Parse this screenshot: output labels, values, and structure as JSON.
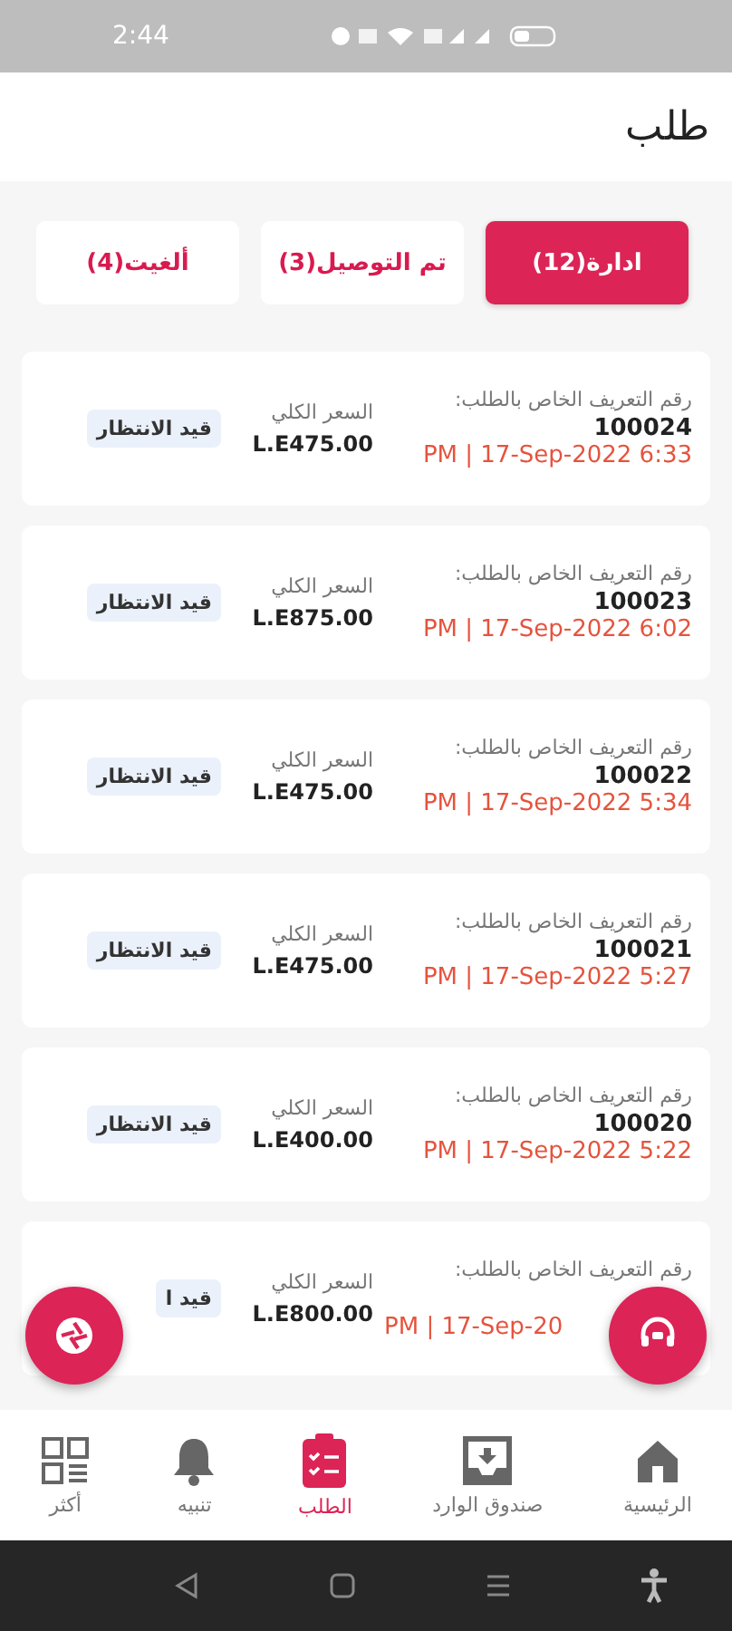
{
  "status_bar": {
    "time": "2:44"
  },
  "header": {
    "title": "طلب"
  },
  "tabs": [
    {
      "label": "ادارة(12)",
      "selected": true
    },
    {
      "label": "تم التوصيل(3)",
      "selected": false
    },
    {
      "label": "ألغيت(4)",
      "selected": false
    }
  ],
  "orders": [
    {
      "id_label": "رقم التعريف الخاص بالطلب:",
      "id": "100024",
      "date": "PM | 17-Sep-2022 6:33",
      "price_label": "السعر الكلي",
      "price": "L.E475.00",
      "status": "قيد الانتظار"
    },
    {
      "id_label": "رقم التعريف الخاص بالطلب:",
      "id": "100023",
      "date": "PM | 17-Sep-2022 6:02",
      "price_label": "السعر الكلي",
      "price": "L.E875.00",
      "status": "قيد الانتظار"
    },
    {
      "id_label": "رقم التعريف الخاص بالطلب:",
      "id": "100022",
      "date": "PM | 17-Sep-2022 5:34",
      "price_label": "السعر الكلي",
      "price": "L.E475.00",
      "status": "قيد الانتظار"
    },
    {
      "id_label": "رقم التعريف الخاص بالطلب:",
      "id": "100021",
      "date": "PM | 17-Sep-2022 5:27",
      "price_label": "السعر الكلي",
      "price": "L.E475.00",
      "status": "قيد الانتظار"
    },
    {
      "id_label": "رقم التعريف الخاص بالطلب:",
      "id": "100020",
      "date": "PM | 17-Sep-2022 5:22",
      "price_label": "السعر الكلي",
      "price": "L.E400.00",
      "status": "قيد الانتظار"
    },
    {
      "id_label": "رقم التعريف الخاص بالطلب:",
      "date": "PM | 17-Sep-20",
      "price_label": "السعر الكلي",
      "price": "L.E800.00",
      "status": "قيد ا"
    }
  ],
  "bottom_nav": [
    {
      "label": "الرئيسية",
      "kind": "home",
      "selected": false
    },
    {
      "label": "صندوق الوارد",
      "kind": "inbox",
      "selected": false
    },
    {
      "label": "الطلب",
      "kind": "orders",
      "selected": true
    },
    {
      "label": "تنبيه",
      "kind": "bell",
      "selected": false
    },
    {
      "label": "أكثر",
      "kind": "more",
      "selected": false
    }
  ]
}
